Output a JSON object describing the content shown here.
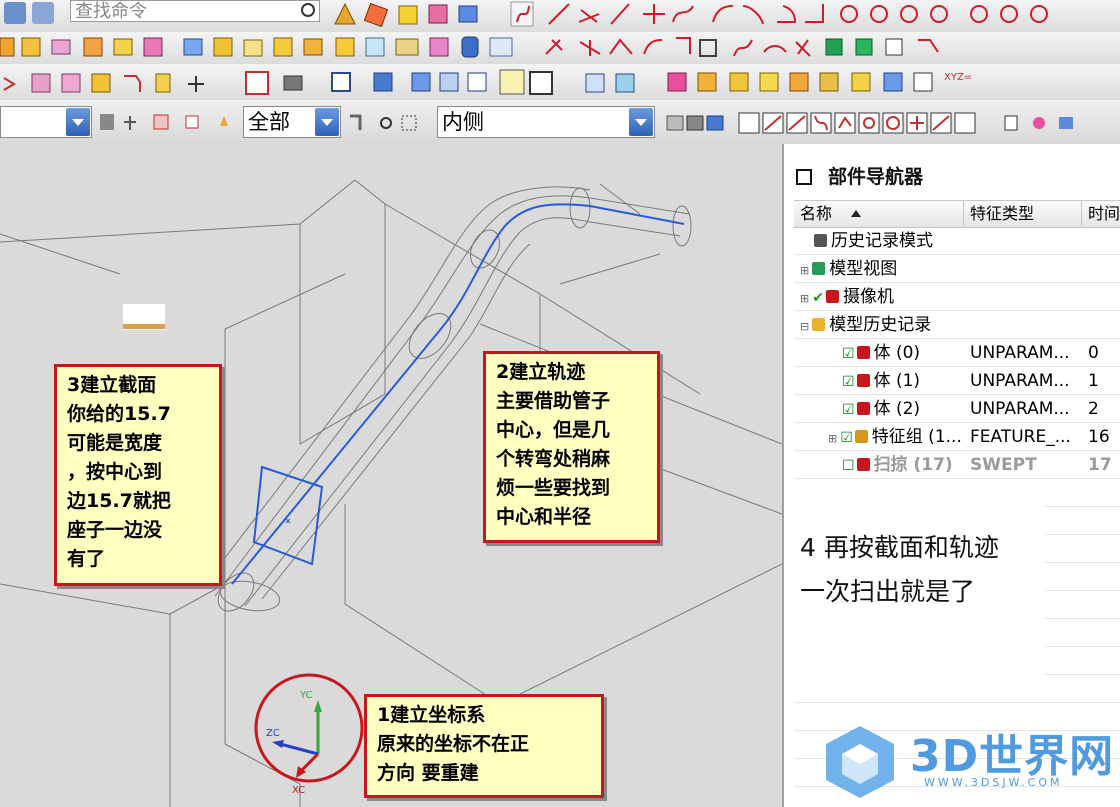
{
  "toolbar": {
    "search_placeholder": "查找命令",
    "selection_filter": "",
    "scope_value": "全部",
    "snap_value": "内侧"
  },
  "navigator": {
    "title": "部件导航器",
    "columns": [
      "名称",
      "特征类型",
      "时间"
    ],
    "rows": [
      {
        "name": "历史记录模式",
        "type": "",
        "time": "",
        "check": false,
        "expander": "",
        "icon": "clock-icon"
      },
      {
        "name": "模型视图",
        "type": "",
        "time": "",
        "check": false,
        "expander": "+",
        "icon": "model-view-icon"
      },
      {
        "name": "摄像机",
        "type": "",
        "time": "",
        "check": true,
        "expander": "+",
        "icon": "camera-icon"
      },
      {
        "name": "模型历史记录",
        "type": "",
        "time": "",
        "check": false,
        "expander": "-",
        "icon": "folder-icon"
      },
      {
        "name": "体 (0)",
        "type": "UNPARAM...",
        "time": "0",
        "check": true,
        "expander": "",
        "icon": "body-icon"
      },
      {
        "name": "体 (1)",
        "type": "UNPARAM...",
        "time": "1",
        "check": true,
        "expander": "",
        "icon": "body-icon"
      },
      {
        "name": "体 (2)",
        "type": "UNPARAM...",
        "time": "2",
        "check": true,
        "expander": "",
        "icon": "body-icon"
      },
      {
        "name": "特征组 (1...",
        "type": "FEATURE_...",
        "time": "16",
        "check": true,
        "expander": "+",
        "icon": "feature-group-icon"
      },
      {
        "name": "扫掠 (17)",
        "type": "SWEPT",
        "time": "17",
        "check": false,
        "expander": "",
        "icon": "swept-icon"
      }
    ]
  },
  "callouts": {
    "step1": [
      "1建立坐标系",
      "原来的坐标不在正",
      "方向       要重建"
    ],
    "step2": [
      "2建立轨迹",
      "主要借助管子",
      "中心，但是几",
      "个转弯处稍麻",
      "烦一些要找到",
      "中心和半径"
    ],
    "step3": [
      "3建立截面",
      "你给的15.7",
      "可能是宽度",
      "，按中心到",
      "边15.7就把",
      "座子一边没",
      "有了"
    ],
    "step4": [
      "4 再按截面和轨迹",
      "一次扫出就是了"
    ]
  },
  "axes": {
    "x": "XC",
    "y": "YC",
    "z": "ZC"
  },
  "watermark": {
    "brand": "3D世界网",
    "url": "WWW.3DSJW.COM"
  },
  "colors": {
    "callout_border": "#c8161d",
    "callout_bg": "#ffffc0",
    "trajectory": "#2a5bd7",
    "accent_blue": "#3d7fe0"
  }
}
